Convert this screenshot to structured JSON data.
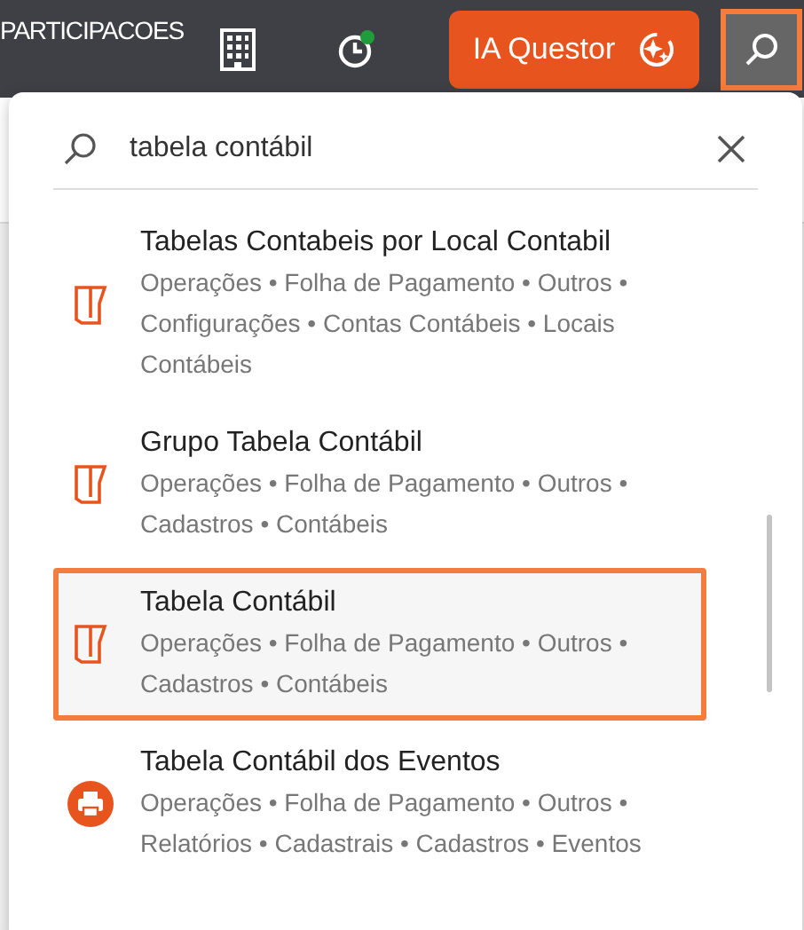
{
  "topbar": {
    "company": "PARTICIPACOES",
    "status_online": true,
    "ai_button": {
      "label": "IA Questor"
    },
    "search_button": {
      "selected": true
    }
  },
  "search": {
    "value": "tabela contábil"
  },
  "results": [
    {
      "kind": "form",
      "title": "Tabelas Contabeis por Local Contabil",
      "path": "Operações • Folha de Pagamento • Outros • Configurações • Contas Contábeis • Locais Contábeis",
      "selected": false
    },
    {
      "kind": "form",
      "title": "Grupo Tabela Contábil",
      "path": "Operações • Folha de Pagamento • Outros • Cadastros • Contábeis",
      "selected": false
    },
    {
      "kind": "form",
      "title": "Tabela Contábil",
      "path": "Operações • Folha de Pagamento • Outros • Cadastros • Contábeis",
      "selected": true
    },
    {
      "kind": "report",
      "title": "Tabela Contábil dos Eventos",
      "path": "Operações • Folha de Pagamento • Outros • Relatórios • Cadastrais • Cadastros • Eventos",
      "selected": false
    }
  ]
}
